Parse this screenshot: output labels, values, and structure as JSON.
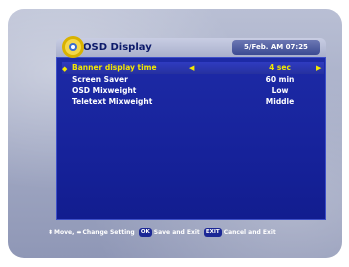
{
  "header": {
    "title": "OSD Display",
    "datetime": "5/Feb. AM 07:25"
  },
  "menu": {
    "items": [
      {
        "label": "Banner display time",
        "value": "4 sec"
      },
      {
        "label": "Screen Saver",
        "value": "60 min"
      },
      {
        "label": "OSD Mixweight",
        "value": "Low"
      },
      {
        "label": "Teletext Mixweight",
        "value": "Middle"
      }
    ]
  },
  "footer": {
    "move_label": "Move,",
    "change_label": "Change Setting",
    "ok_badge": "OK",
    "save_label": "Save and Exit",
    "exit_badge": "EXIT",
    "cancel_label": "Cancel and Exit"
  },
  "icons": {
    "logo": "satellite-dish-logo-icon",
    "selection_marker": "diamond-marker-icon",
    "left_arrow": "left-arrow-icon",
    "right_arrow": "right-arrow-icon",
    "updown": "up-down-icon",
    "leftright": "left-right-icon"
  },
  "colors": {
    "panel": "#16229a",
    "selected_text": "#f4e800",
    "text": "#ffffff",
    "title_text": "#0c1a6a"
  }
}
